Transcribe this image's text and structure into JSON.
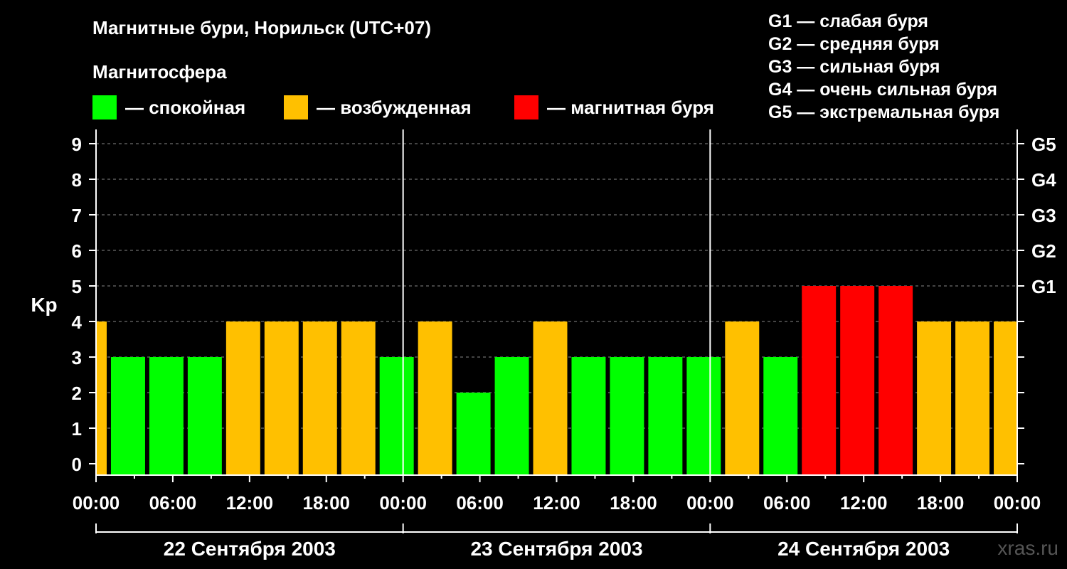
{
  "title": "Магнитные бури, Норильск (UTC+07)",
  "subtitle": "Магнитосфера",
  "legend": [
    {
      "color": "#00ff00",
      "label": "— спокойная"
    },
    {
      "color": "#ffc000",
      "label": "— возбужденная"
    },
    {
      "color": "#ff0000",
      "label": "— магнитная буря"
    }
  ],
  "g_scale": [
    "G1 — слабая буря",
    "G2 — средняя буря",
    "G3 — сильная буря",
    "G4 — очень сильная буря",
    "G5 — экстремальная буря"
  ],
  "watermark": "xras.ru",
  "chart_data": {
    "type": "bar",
    "title": "Магнитные бури, Норильск (UTC+07)",
    "ylabel": "Kp",
    "ylim": [
      0,
      9
    ],
    "yticks": [
      0,
      1,
      2,
      3,
      4,
      5,
      6,
      7,
      8,
      9
    ],
    "right_ticks": [
      {
        "value": 5,
        "label": "G1"
      },
      {
        "value": 6,
        "label": "G2"
      },
      {
        "value": 7,
        "label": "G3"
      },
      {
        "value": 8,
        "label": "G4"
      },
      {
        "value": 9,
        "label": "G5"
      }
    ],
    "x_tick_labels": [
      "00:00",
      "06:00",
      "12:00",
      "18:00",
      "00:00",
      "06:00",
      "12:00",
      "18:00",
      "00:00",
      "06:00",
      "12:00",
      "18:00",
      "00:00"
    ],
    "days": [
      "22 Сентября 2003",
      "23 Сентября 2003",
      "24 Сентября 2003"
    ],
    "colors": {
      "quiet": "#00ff00",
      "active": "#ffc000",
      "storm": "#ff0000"
    },
    "grid": true,
    "bars": [
      {
        "start_hour": 0,
        "end_hour": 1,
        "kp": 4
      },
      {
        "start_hour": 1,
        "end_hour": 4,
        "kp": 3
      },
      {
        "start_hour": 4,
        "end_hour": 7,
        "kp": 3
      },
      {
        "start_hour": 7,
        "end_hour": 10,
        "kp": 3
      },
      {
        "start_hour": 10,
        "end_hour": 13,
        "kp": 4
      },
      {
        "start_hour": 13,
        "end_hour": 16,
        "kp": 4
      },
      {
        "start_hour": 16,
        "end_hour": 19,
        "kp": 4
      },
      {
        "start_hour": 19,
        "end_hour": 22,
        "kp": 4
      },
      {
        "start_hour": 22,
        "end_hour": 25,
        "kp": 3
      },
      {
        "start_hour": 25,
        "end_hour": 28,
        "kp": 4
      },
      {
        "start_hour": 28,
        "end_hour": 31,
        "kp": 2
      },
      {
        "start_hour": 31,
        "end_hour": 34,
        "kp": 3
      },
      {
        "start_hour": 34,
        "end_hour": 37,
        "kp": 4
      },
      {
        "start_hour": 37,
        "end_hour": 40,
        "kp": 3
      },
      {
        "start_hour": 40,
        "end_hour": 43,
        "kp": 3
      },
      {
        "start_hour": 43,
        "end_hour": 46,
        "kp": 3
      },
      {
        "start_hour": 46,
        "end_hour": 49,
        "kp": 3
      },
      {
        "start_hour": 49,
        "end_hour": 52,
        "kp": 4
      },
      {
        "start_hour": 52,
        "end_hour": 55,
        "kp": 3
      },
      {
        "start_hour": 55,
        "end_hour": 58,
        "kp": 5
      },
      {
        "start_hour": 58,
        "end_hour": 61,
        "kp": 5
      },
      {
        "start_hour": 61,
        "end_hour": 64,
        "kp": 5
      },
      {
        "start_hour": 64,
        "end_hour": 67,
        "kp": 4
      },
      {
        "start_hour": 67,
        "end_hour": 70,
        "kp": 4
      },
      {
        "start_hour": 70,
        "end_hour": 72,
        "kp": 4
      }
    ]
  }
}
